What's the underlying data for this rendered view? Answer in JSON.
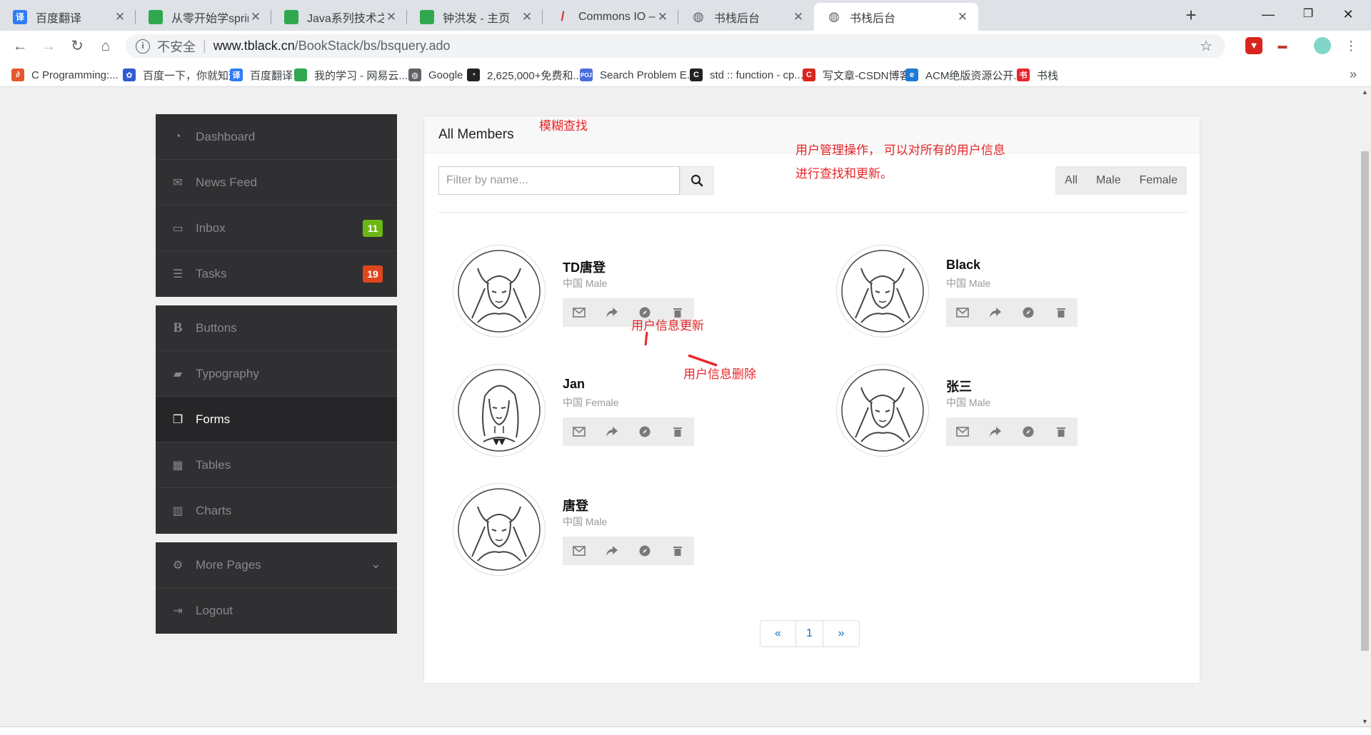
{
  "browser": {
    "tabs": [
      {
        "title": "百度翻译",
        "icon": "baidu-translate-icon",
        "color": "#2f7cf6",
        "glyph": "译"
      },
      {
        "title": "从零开始学spring boot",
        "icon": "green-book-icon",
        "color": "#2fa84f",
        "glyph": ""
      },
      {
        "title": "Java系列技术之JavaWeb",
        "icon": "green-book-icon",
        "color": "#2fa84f",
        "glyph": ""
      },
      {
        "title": "钟洪发 - 主页",
        "icon": "green-book-icon",
        "color": "#2fa84f",
        "glyph": ""
      },
      {
        "title": "Commons IO – Download",
        "icon": "feather-icon",
        "color": "#d0312d",
        "glyph": "/"
      },
      {
        "title": "书栈后台",
        "icon": "globe-icon",
        "color": "#5f6368",
        "glyph": ""
      },
      {
        "title": "书栈后台",
        "icon": "globe-icon",
        "color": "#5f6368",
        "glyph": ""
      }
    ],
    "new_tab": "+",
    "window_controls": {
      "minimize": "—",
      "restore": "❐",
      "close": "✕"
    },
    "address": {
      "security_label": "不安全",
      "host": "www.tblack.cn",
      "path": "/BookStack/bs/bsquery.ado"
    },
    "bookmarks": [
      {
        "label": "C Programming:...",
        "color": "#e4572e",
        "glyph": "∂"
      },
      {
        "label": "百度一下，你就知道",
        "color": "#2f5bd3",
        "glyph": "✿"
      },
      {
        "label": "百度翻译",
        "color": "#2f7cf6",
        "glyph": "译"
      },
      {
        "label": "我的学习 - 网易云...",
        "color": "#2fa84f",
        "glyph": ""
      },
      {
        "label": "Google",
        "color": "#5f6368",
        "glyph": "◍"
      },
      {
        "label": "2,625,000+免费和...",
        "color": "#222222",
        "glyph": "◔"
      },
      {
        "label": "Search Problem E...",
        "color": "#4a6fdc",
        "glyph": "POJ"
      },
      {
        "label": "std :: function - cp...",
        "color": "#222222",
        "glyph": "C"
      },
      {
        "label": "写文章-CSDN博客",
        "color": "#d9251d",
        "glyph": "C"
      },
      {
        "label": "ACM绝版资源公开...",
        "color": "#1e7bd6",
        "glyph": "e"
      },
      {
        "label": "书栈",
        "color": "#e8262a",
        "glyph": "书"
      }
    ]
  },
  "sidebar": {
    "groups": [
      [
        {
          "label": "Dashboard",
          "icon": "dashboard-icon",
          "glyph": "◔"
        },
        {
          "label": "News Feed",
          "icon": "bullhorn-icon",
          "glyph": "✉"
        },
        {
          "label": "Inbox",
          "icon": "inbox-icon",
          "glyph": "▭",
          "badge": "11",
          "badge_color": "#6bb814"
        },
        {
          "label": "Tasks",
          "icon": "tasks-icon",
          "glyph": "☰",
          "badge": "19",
          "badge_color": "#e0461e"
        }
      ],
      [
        {
          "label": "Buttons",
          "icon": "bold-icon",
          "glyph": "B"
        },
        {
          "label": "Typography",
          "icon": "book-icon",
          "glyph": "▰"
        },
        {
          "label": "Forms",
          "icon": "copy-icon",
          "glyph": "❐",
          "active": true
        },
        {
          "label": "Tables",
          "icon": "table-icon",
          "glyph": "▦"
        },
        {
          "label": "Charts",
          "icon": "bar-chart-icon",
          "glyph": "▥"
        }
      ],
      [
        {
          "label": "More Pages",
          "icon": "gear-icon",
          "glyph": "⚙",
          "chevron": "⌄"
        },
        {
          "label": "Logout",
          "icon": "sign-out-icon",
          "glyph": "⇥"
        }
      ]
    ]
  },
  "panel": {
    "title": "All Members",
    "search": {
      "placeholder": "Filter by name...",
      "value": ""
    },
    "filters": [
      "All",
      "Male",
      "Female"
    ],
    "members": [
      {
        "name": "TD唐登",
        "country": "中国",
        "gender": "Male",
        "avatar": "male"
      },
      {
        "name": "Black",
        "country": "中国",
        "gender": "Male",
        "avatar": "male"
      },
      {
        "name": "Jan",
        "country": "中国",
        "gender": "Female",
        "avatar": "female"
      },
      {
        "name": "张三",
        "country": "中国",
        "gender": "Male",
        "avatar": "male"
      },
      {
        "name": "唐登",
        "country": "中国",
        "gender": "Male",
        "avatar": "male"
      }
    ],
    "actions": [
      "envelope-icon",
      "share-icon",
      "compass-icon",
      "trash-icon"
    ],
    "pagination": {
      "prev": "«",
      "pages": [
        "1"
      ],
      "next": "»"
    }
  },
  "annotations": {
    "fuzzy_search": "模糊查找",
    "manage_line1": "用户管理操作， 可以对所有的用户信息",
    "manage_line2": "进行查找和更新。",
    "update": "用户信息更新",
    "delete": "用户信息删除",
    "color": "#e8262a"
  }
}
